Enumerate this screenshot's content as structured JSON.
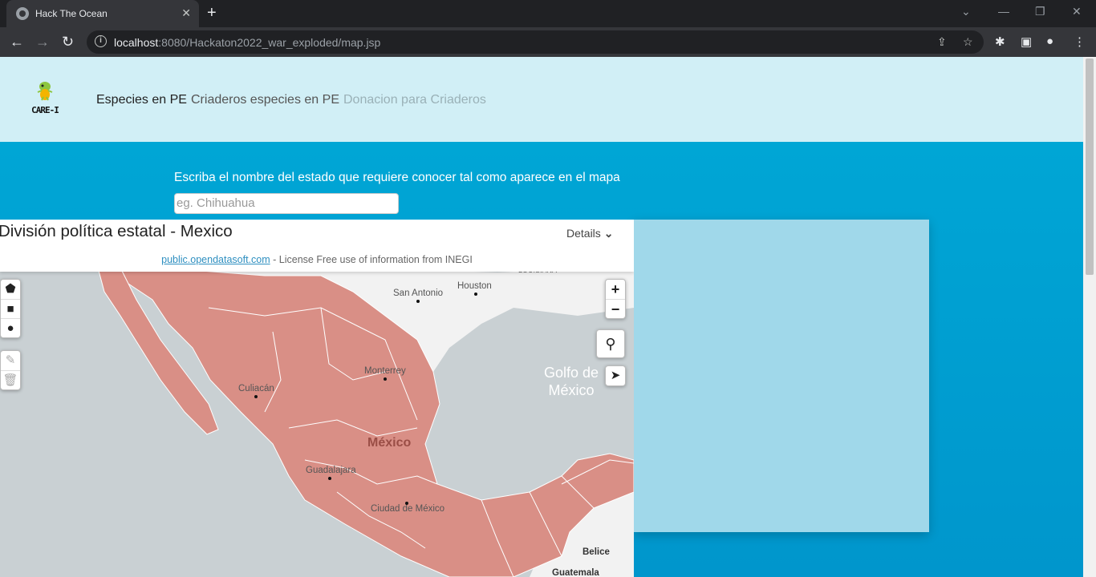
{
  "browser": {
    "tab_title": "Hack The Ocean",
    "url_host": "localhost",
    "url_rest": ":8080/Hackaton2022_war_exploded/map.jsp"
  },
  "header": {
    "brand": "CARE-I",
    "menu": [
      {
        "label": "Especies en PE",
        "state": "active"
      },
      {
        "label": "Criaderos especies en PE",
        "state": "normal"
      },
      {
        "label": "Donacion para Criaderos",
        "state": "disabled"
      }
    ]
  },
  "search": {
    "prompt": "Escriba el nombre del estado que requiere conocer tal como aparece en el mapa",
    "placeholder": "eg. Chihuahua"
  },
  "map": {
    "title": "División política estatal - Mexico",
    "details_label": "Details",
    "source_link": "public.opendatasoft.com",
    "license_text": " - License Free use of information from INEGI",
    "zoom_in": "+",
    "zoom_out": "−",
    "labels": {
      "san_antonio": "San Antonio",
      "houston": "Houston",
      "louisiana": "LOUISIANA",
      "gulf": "Golfo de\nMéxico",
      "monterrey": "Monterrey",
      "culiacan": "Culiacán",
      "mexico": "México",
      "guadalajara": "Guadalajara",
      "cdmx": "Ciudad de México",
      "belice": "Belice",
      "guatemala": "Guatemala"
    },
    "colors": {
      "states": "#d98f86",
      "water": "#c9d0d3",
      "land": "#f2f2f2"
    }
  }
}
